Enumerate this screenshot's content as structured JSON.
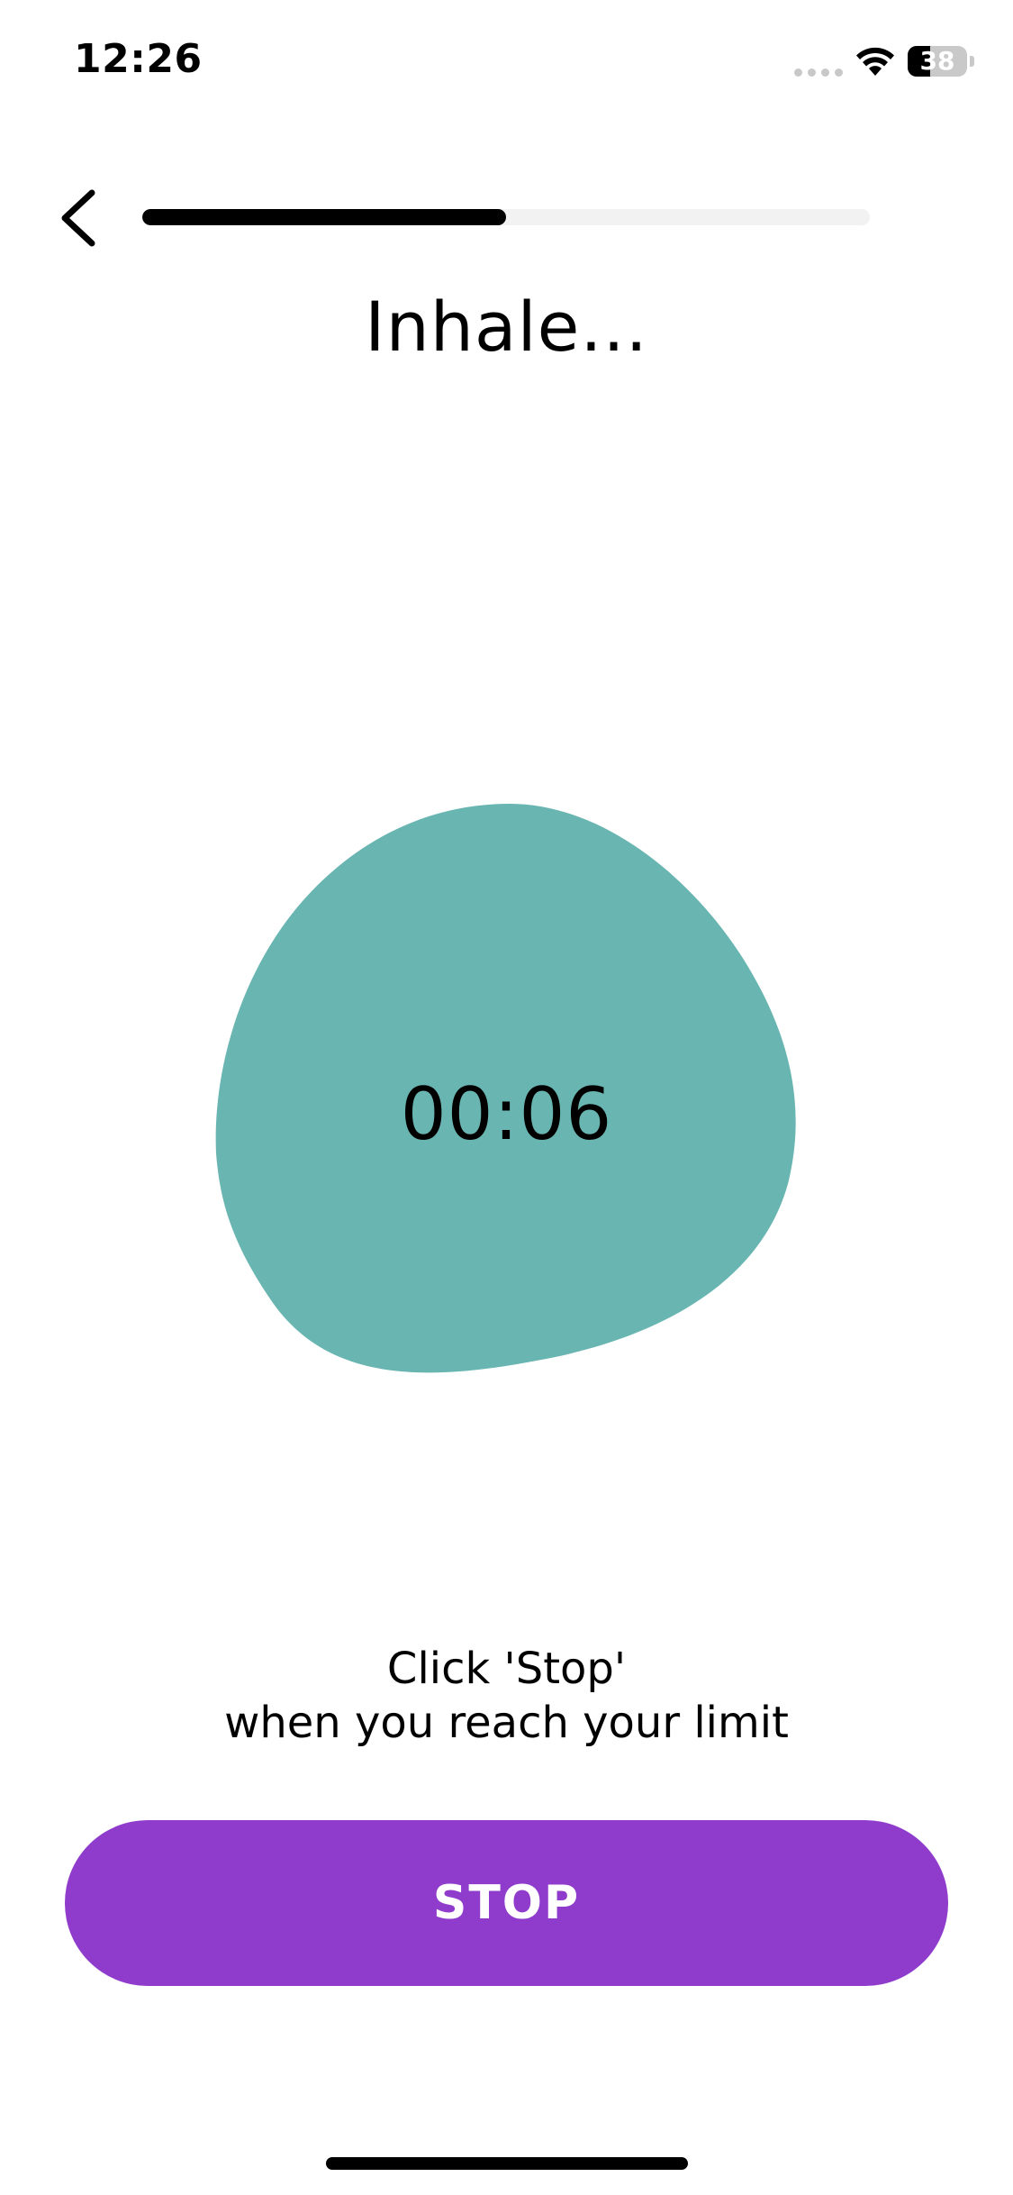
{
  "status_bar": {
    "time": "12:26",
    "battery_level": "38",
    "battery_fraction": 0.38
  },
  "header": {
    "progress_fraction": 0.5
  },
  "exercise": {
    "phase": "Inhale...",
    "timer": "00:06",
    "blob_color": "#68b5b1"
  },
  "instruction": {
    "line1": "Click 'Stop'",
    "line2": "when you reach your limit"
  },
  "actions": {
    "stop_label": "STOP",
    "stop_color": "#8f3bcb"
  }
}
